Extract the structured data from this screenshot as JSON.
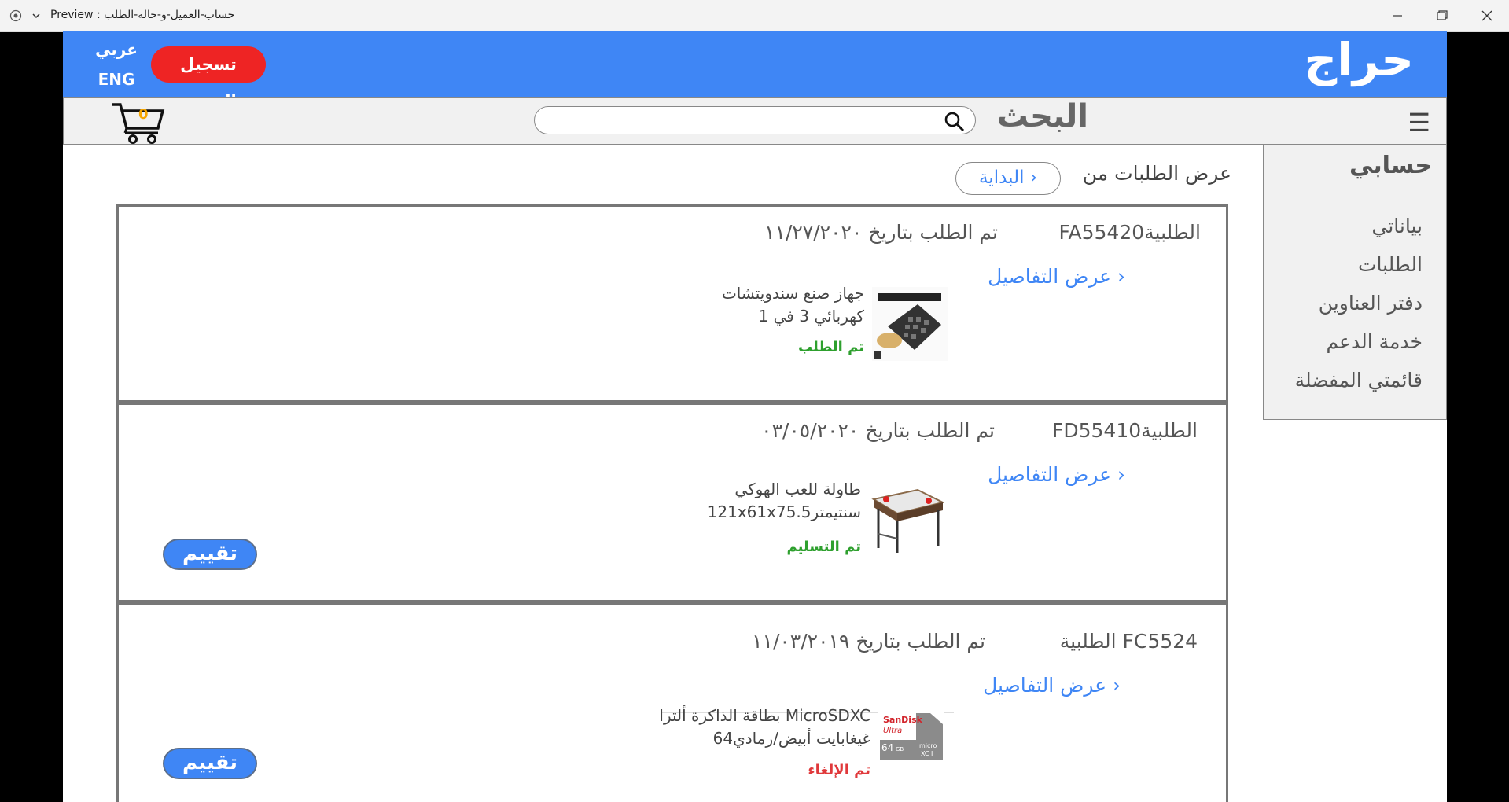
{
  "window": {
    "title": "Preview : حساب-العميل-و-حالة-الطلب"
  },
  "header": {
    "logo": "حراج",
    "logout_label": "تسجيل الخروج",
    "lang_arabic": "عربي",
    "lang_english": "ENG"
  },
  "navbar": {
    "menu_icon": "☰",
    "search_label": "البحث",
    "search_value": "",
    "cart_count": "0"
  },
  "sidebar": {
    "title": "حسابي",
    "items": [
      {
        "label": "بياناتي"
      },
      {
        "label": "الطلبات"
      },
      {
        "label": "دفتر العناوين"
      },
      {
        "label": "خدمة الدعم"
      },
      {
        "label": "قائمتي المفضلة"
      }
    ]
  },
  "filter": {
    "label": "عرض الطلبات من",
    "value": "البداية ›"
  },
  "orders": [
    {
      "id": "FA55420الطلبية",
      "date": "تم الطلب  بتاريخ ١١/٢٧/٢٠٢٠",
      "details": "عرض التفاصيل ›",
      "product_line1": "جهاز صنع سندويتشات",
      "product_line2": "كهربائي 3 في 1",
      "status": "تم الطلب",
      "status_color": "#2ea02e"
    },
    {
      "id": "FD55410الطلبية",
      "date": "تم الطلب  بتاريخ ٠٣/٠٥/٢٠٢٠",
      "details": "عرض التفاصيل ›",
      "product_line1": "طاولة للعب الهوكي",
      "product_line2": "121x61x75.5سنتيمتر",
      "status": "تم التسليم",
      "status_color": "#2ea02e",
      "rate_label": "تقييم"
    },
    {
      "id": "الطلبية FC5524",
      "date": "تم الطلب  بتاريخ ١١/٠٣/٢٠١٩",
      "details": "عرض التفاصيل ›",
      "product_line1": "بطاقة الذاكرة ألترا MicroSDXC",
      "product_line2": "64غيغابايت أبيض/رمادي",
      "status": "تم الإلغاء",
      "status_color": "#e0393b",
      "rate_label": "تقييم"
    }
  ],
  "colors": {
    "accent": "#3f86f5",
    "logout": "#ee2424",
    "cart_count": "#f7a600"
  }
}
